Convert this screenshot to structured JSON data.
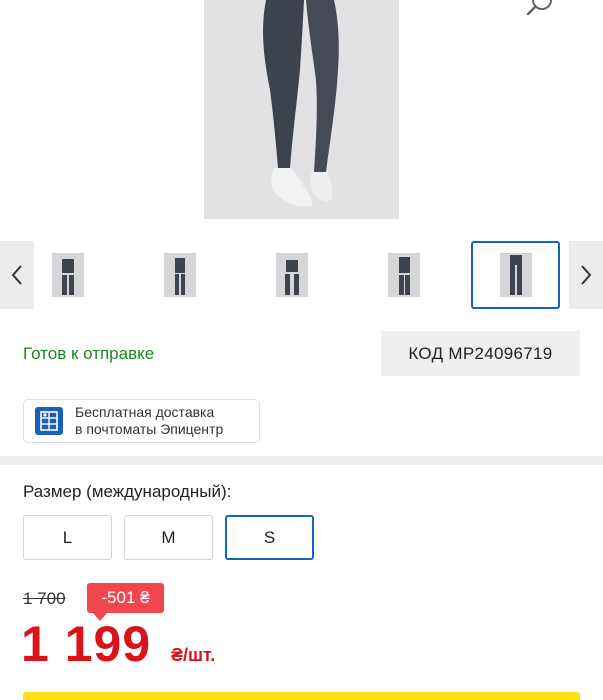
{
  "product": {
    "status": "Готов к отправке",
    "code": "КОД МР24096719"
  },
  "carousel": {
    "prev_icon": "chevron-left-icon",
    "next_icon": "chevron-right-icon",
    "thumbnails": [
      {
        "alt": "thumb-1",
        "active": false
      },
      {
        "alt": "thumb-2",
        "active": false
      },
      {
        "alt": "thumb-3",
        "active": false
      },
      {
        "alt": "thumb-4",
        "active": false
      },
      {
        "alt": "thumb-5",
        "active": true
      }
    ]
  },
  "delivery": {
    "line1": "Бесплатная доставка",
    "line2": "в почтоматы Эпицентр",
    "icon": "parcel-locker-icon",
    "icon_color": "#1c5fb8"
  },
  "sizes": {
    "title": "Размер (международный):",
    "options": [
      "L",
      "M",
      "S"
    ],
    "selected": "S"
  },
  "price": {
    "old": "1 700",
    "discount": "-501 ₴",
    "current": "1 199",
    "unit": "₴/шт."
  },
  "colors": {
    "accent": "#1565c0",
    "price": "#d6141a",
    "discount": "#f0474e",
    "status": "#1a8a1a",
    "buy": "#ffde1a"
  }
}
